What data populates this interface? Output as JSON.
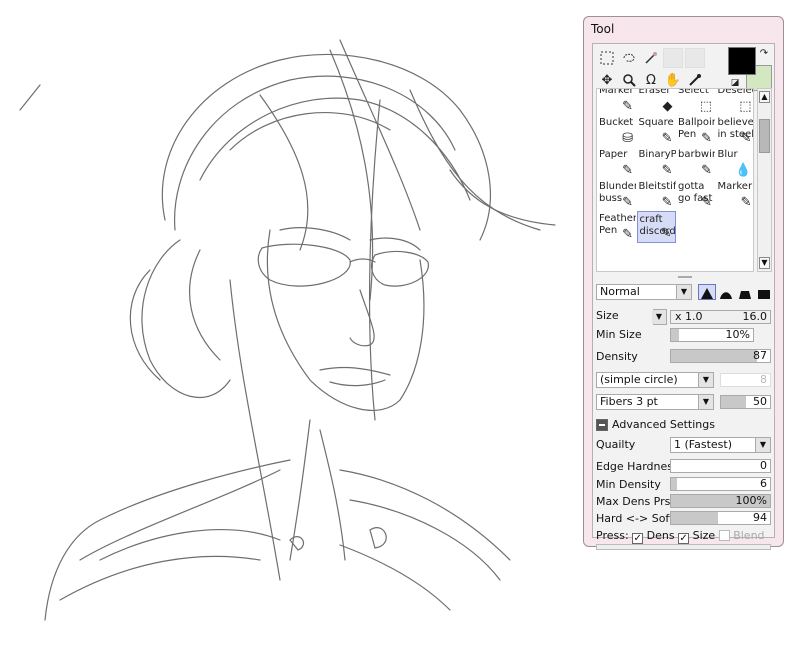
{
  "panel": {
    "title": "Tool",
    "fg_color": "#000000",
    "bg_color": "#d3e8c0",
    "accent_color": "#8590d8"
  },
  "tools": [
    {
      "label": "Marker",
      "icon": "pen-icon"
    },
    {
      "label": "Eraser",
      "icon": "eraser-icon"
    },
    {
      "label": "Select",
      "icon": "select-icon"
    },
    {
      "label": "Deselect",
      "icon": "deselect-icon"
    },
    {
      "label": "Bucket",
      "icon": "bucket-icon"
    },
    {
      "label": "Square",
      "icon": "pen-icon"
    },
    {
      "label": "Ballpoint\nPen",
      "icon": "pen-icon"
    },
    {
      "label": "believe\nin steel",
      "icon": "pen-icon"
    },
    {
      "label": "Paper",
      "icon": "pen-icon"
    },
    {
      "label": "BinaryPe",
      "icon": "pen-icon"
    },
    {
      "label": "barbwire",
      "icon": "pen-icon"
    },
    {
      "label": "Blur",
      "icon": "blur-icon"
    },
    {
      "label": "Blunder\nbuss",
      "icon": "pen-icon"
    },
    {
      "label": "Bleitstift",
      "icon": "pen-icon"
    },
    {
      "label": "gotta\ngo fast",
      "icon": "pen-icon"
    },
    {
      "label": "Marker",
      "icon": "pen-icon"
    },
    {
      "label": "Feather\nPen",
      "icon": "pen-icon"
    },
    {
      "label": "craft\ndiscord",
      "icon": "pen-icon"
    }
  ],
  "selected_tool": "craft discord",
  "blend_mode": "Normal",
  "size": {
    "label": "Size",
    "multiplier": "x 1.0",
    "value": "16.0"
  },
  "min_size": {
    "label": "Min Size",
    "value": "10%",
    "fraction": 0.1
  },
  "density": {
    "label": "Density",
    "value": "87",
    "fraction": 0.87
  },
  "brush_shape": {
    "value": "(simple circle)",
    "amount": "8"
  },
  "texture": {
    "value": "Fibers 3 pt",
    "amount": "50",
    "fraction": 0.5
  },
  "advanced": {
    "label": "Advanced Settings"
  },
  "quality": {
    "label": "Quailty",
    "value": "1 (Fastest)"
  },
  "edge_hardness": {
    "label": "Edge Hardness",
    "value": "0",
    "fraction": 0.0
  },
  "min_density": {
    "label": "Min Density",
    "value": "6",
    "fraction": 0.06
  },
  "max_dens_prs": {
    "label": "Max Dens Prs.",
    "value": "100%",
    "fraction": 1.0
  },
  "hard_soft": {
    "label": "Hard <-> Soft",
    "value": "94",
    "fraction": 0.47
  },
  "press": {
    "label": "Press:",
    "dens": "Dens",
    "size": "Size",
    "blend": "Blend"
  }
}
